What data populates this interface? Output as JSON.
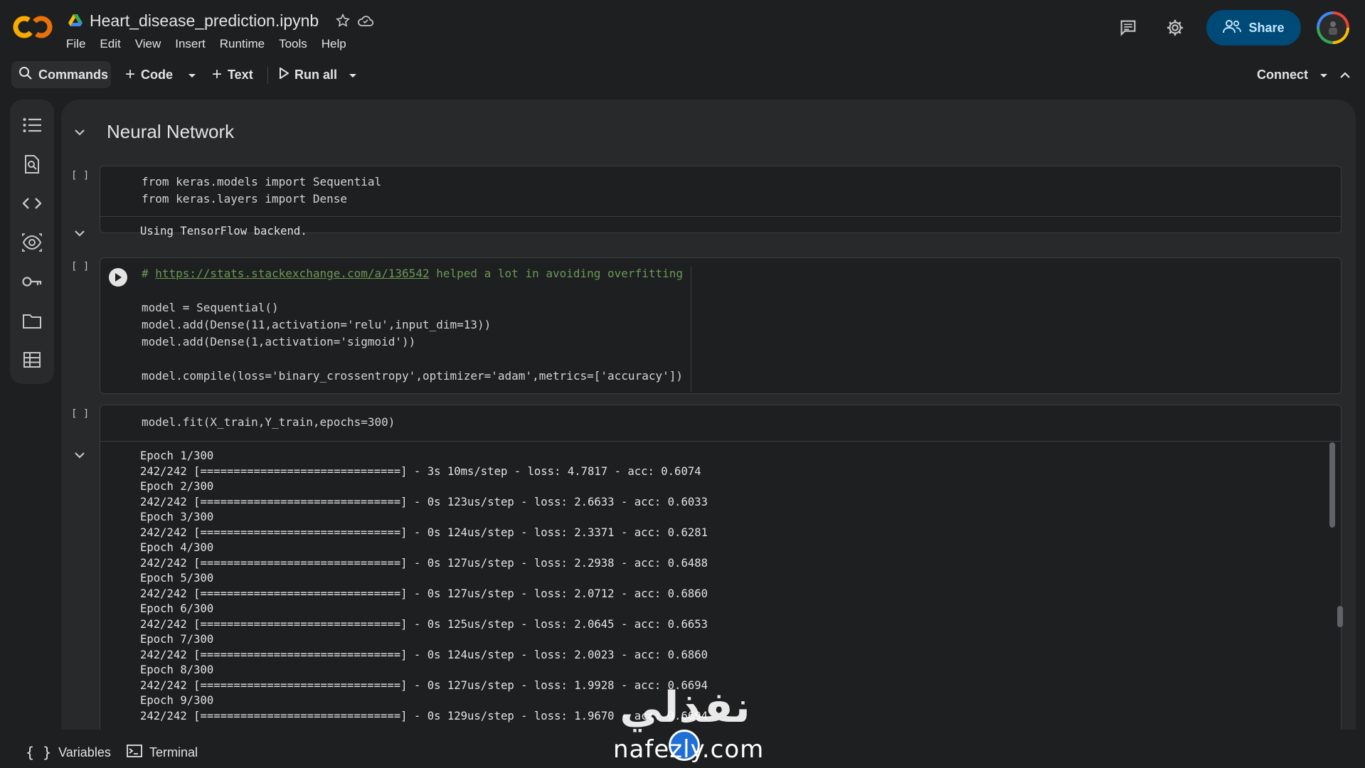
{
  "header": {
    "doc_title": "Heart_disease_prediction.ipynb",
    "menu": [
      "File",
      "Edit",
      "View",
      "Insert",
      "Runtime",
      "Tools",
      "Help"
    ],
    "share_label": "Share"
  },
  "toolbar": {
    "commands_label": "Commands",
    "code_label": "Code",
    "text_label": "Text",
    "run_all_label": "Run all",
    "connect_label": "Connect"
  },
  "notebook": {
    "section_title": "Neural Network",
    "cell_bracket": "[ ]",
    "cell1": {
      "code": [
        "from keras.models import Sequential",
        "from keras.layers import Dense"
      ],
      "output": "Using TensorFlow backend."
    },
    "cell2": {
      "comment_prefix": "# ",
      "link": "https://stats.stackexchange.com/a/136542",
      "comment_suffix": " helped a lot in avoiding overfitting",
      "code": [
        "model = Sequential()",
        "model.add(Dense(11,activation='relu',input_dim=13))",
        "model.add(Dense(1,activation='sigmoid'))",
        "model.compile(loss='binary_crossentropy',optimizer='adam',metrics=['accuracy'])"
      ]
    },
    "cell3": {
      "code": "model.fit(X_train,Y_train,epochs=300)",
      "output": [
        "Epoch 1/300",
        "242/242 [==============================] - 3s 10ms/step - loss: 4.7817 - acc: 0.6074",
        "Epoch 2/300",
        "242/242 [==============================] - 0s 123us/step - loss: 2.6633 - acc: 0.6033",
        "Epoch 3/300",
        "242/242 [==============================] - 0s 124us/step - loss: 2.3371 - acc: 0.6281",
        "Epoch 4/300",
        "242/242 [==============================] - 0s 127us/step - loss: 2.2938 - acc: 0.6488",
        "Epoch 5/300",
        "242/242 [==============================] - 0s 127us/step - loss: 2.0712 - acc: 0.6860",
        "Epoch 6/300",
        "242/242 [==============================] - 0s 125us/step - loss: 2.0645 - acc: 0.6653",
        "Epoch 7/300",
        "242/242 [==============================] - 0s 124us/step - loss: 2.0023 - acc: 0.6860",
        "Epoch 8/300",
        "242/242 [==============================] - 0s 127us/step - loss: 1.9928 - acc: 0.6694",
        "Epoch 9/300",
        "242/242 [==============================] - 0s 129us/step - loss: 1.9670 - acc: 0.6694"
      ]
    }
  },
  "bottom": {
    "variables_label": "Variables",
    "terminal_label": "Terminal"
  },
  "watermark": {
    "arabic": "نفذلي",
    "latin": "nafezly.com"
  },
  "colors": {
    "accent": "#004a77",
    "share_text": "#c2e7ff",
    "background": "#1e1f20",
    "logo_orange": "#f9ab00"
  }
}
